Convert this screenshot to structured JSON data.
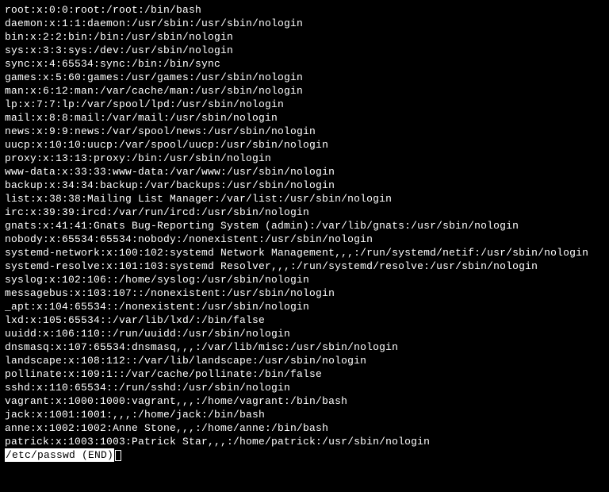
{
  "terminal": {
    "lines": [
      "root:x:0:0:root:/root:/bin/bash",
      "daemon:x:1:1:daemon:/usr/sbin:/usr/sbin/nologin",
      "bin:x:2:2:bin:/bin:/usr/sbin/nologin",
      "sys:x:3:3:sys:/dev:/usr/sbin/nologin",
      "sync:x:4:65534:sync:/bin:/bin/sync",
      "games:x:5:60:games:/usr/games:/usr/sbin/nologin",
      "man:x:6:12:man:/var/cache/man:/usr/sbin/nologin",
      "lp:x:7:7:lp:/var/spool/lpd:/usr/sbin/nologin",
      "mail:x:8:8:mail:/var/mail:/usr/sbin/nologin",
      "news:x:9:9:news:/var/spool/news:/usr/sbin/nologin",
      "uucp:x:10:10:uucp:/var/spool/uucp:/usr/sbin/nologin",
      "proxy:x:13:13:proxy:/bin:/usr/sbin/nologin",
      "www-data:x:33:33:www-data:/var/www:/usr/sbin/nologin",
      "backup:x:34:34:backup:/var/backups:/usr/sbin/nologin",
      "list:x:38:38:Mailing List Manager:/var/list:/usr/sbin/nologin",
      "irc:x:39:39:ircd:/var/run/ircd:/usr/sbin/nologin",
      "gnats:x:41:41:Gnats Bug-Reporting System (admin):/var/lib/gnats:/usr/sbin/nologin",
      "nobody:x:65534:65534:nobody:/nonexistent:/usr/sbin/nologin",
      "systemd-network:x:100:102:systemd Network Management,,,:/run/systemd/netif:/usr/sbin/nologin",
      "systemd-resolve:x:101:103:systemd Resolver,,,:/run/systemd/resolve:/usr/sbin/nologin",
      "syslog:x:102:106::/home/syslog:/usr/sbin/nologin",
      "messagebus:x:103:107::/nonexistent:/usr/sbin/nologin",
      "_apt:x:104:65534::/nonexistent:/usr/sbin/nologin",
      "lxd:x:105:65534::/var/lib/lxd/:/bin/false",
      "uuidd:x:106:110::/run/uuidd:/usr/sbin/nologin",
      "dnsmasq:x:107:65534:dnsmasq,,,:/var/lib/misc:/usr/sbin/nologin",
      "landscape:x:108:112::/var/lib/landscape:/usr/sbin/nologin",
      "pollinate:x:109:1::/var/cache/pollinate:/bin/false",
      "sshd:x:110:65534::/run/sshd:/usr/sbin/nologin",
      "vagrant:x:1000:1000:vagrant,,,:/home/vagrant:/bin/bash",
      "jack:x:1001:1001:,,,:/home/jack:/bin/bash",
      "anne:x:1002:1002:Anne Stone,,,:/home/anne:/bin/bash",
      "patrick:x:1003:1003:Patrick Star,,,:/home/patrick:/usr/sbin/nologin"
    ],
    "status": "/etc/passwd (END)"
  }
}
